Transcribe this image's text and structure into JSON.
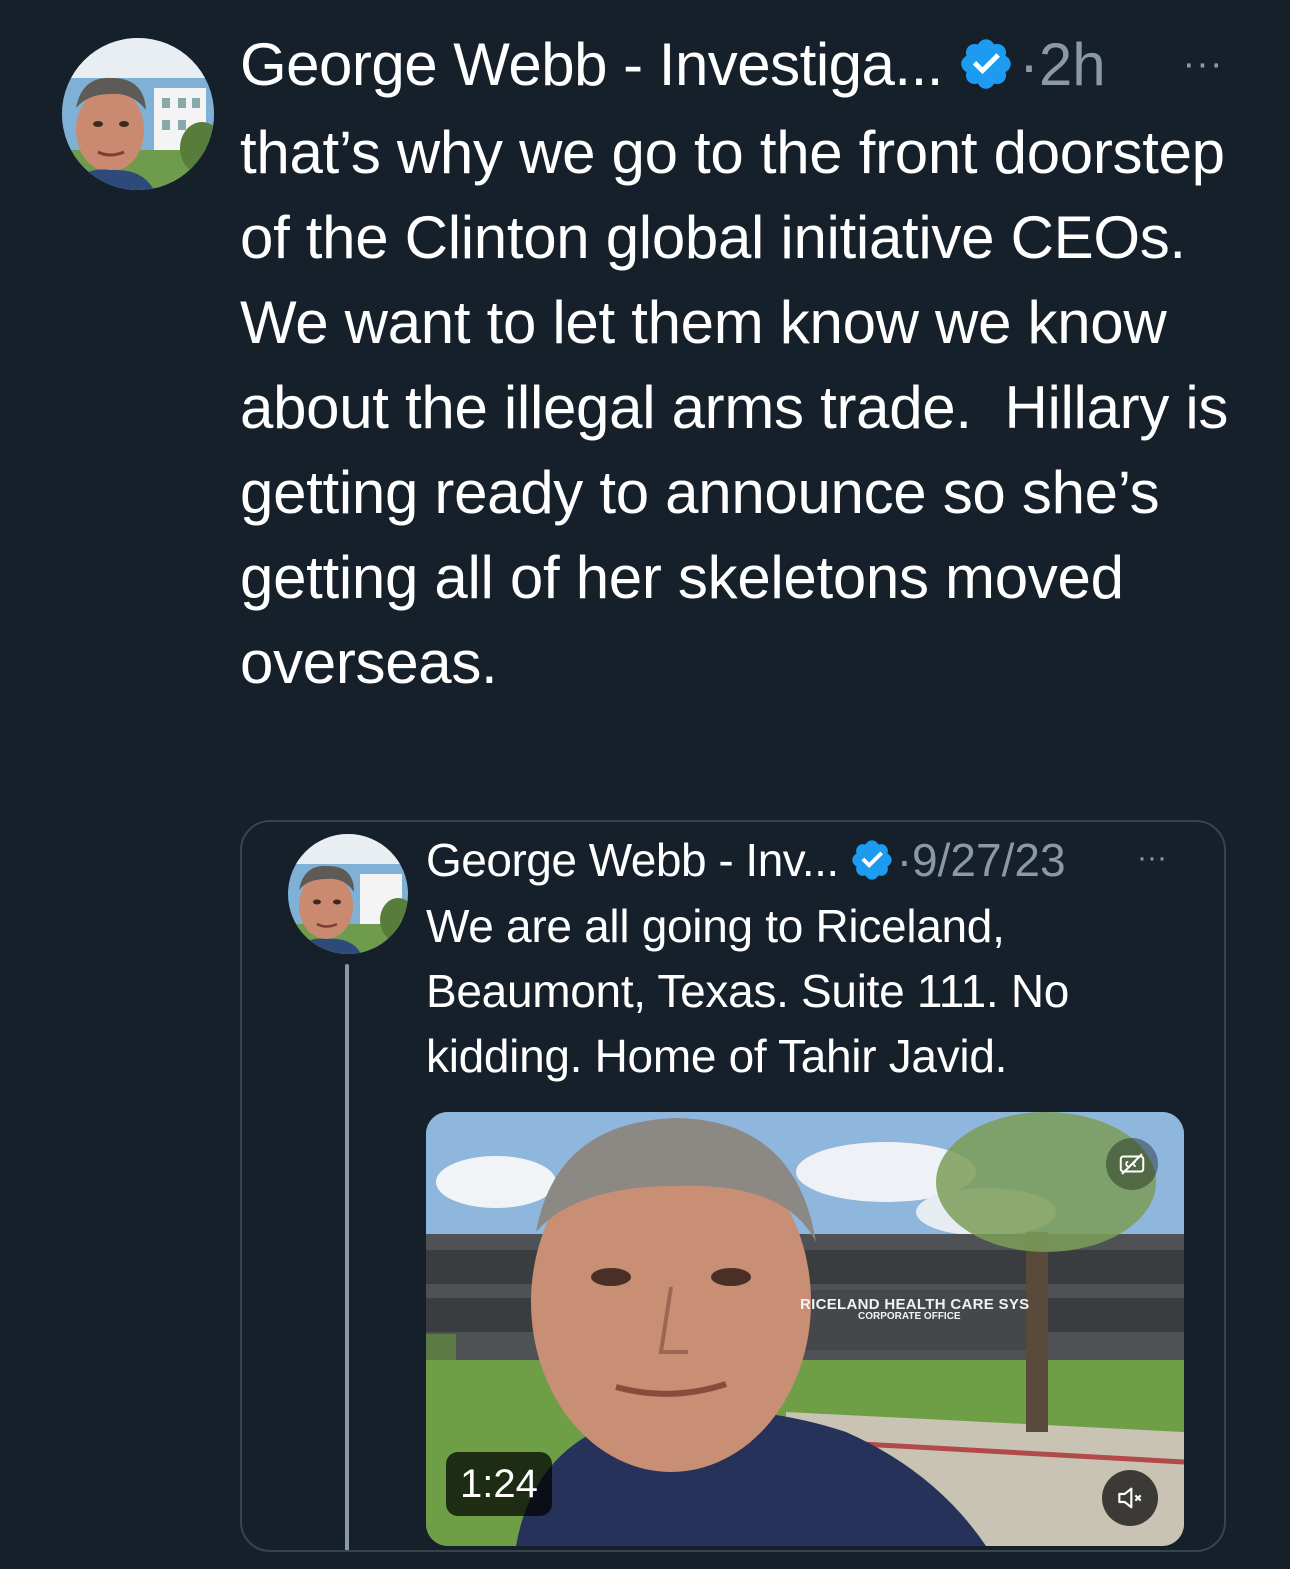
{
  "tweet": {
    "author_name": "George Webb - Investiga...",
    "separator": "·",
    "timestamp": "2h",
    "more_label": "···",
    "text": "that’s why we go to the front doorstep of the Clinton global initiative CEOs. We want to let them know we know about the illegal arms trade.  Hillary is getting ready to announce so she’s getting all of her skeletons moved overseas."
  },
  "quoted_tweet": {
    "author_name": "George Webb - Inv...",
    "separator": "·",
    "date": "9/27/23",
    "more_label": "···",
    "text": "We are all going to Riceland, Beaumont, Texas. Suite 111. No kidding. Home of Tahir Javid.",
    "video": {
      "duration": "1:24",
      "sign_text": "RICELAND HEALTH CARE SYS",
      "sign_subtext": "CORPORATE OFFICE"
    }
  },
  "colors": {
    "background": "#15202b",
    "primary_text": "#ffffff",
    "secondary_text": "#8b98a5",
    "border": "#38444d",
    "verified_badge": "#1d9bf0"
  },
  "icons": {
    "verified": "verified-badge-icon",
    "more": "more-horizontal-icon",
    "mute": "speaker-muted-icon",
    "captions": "captions-off-icon"
  }
}
